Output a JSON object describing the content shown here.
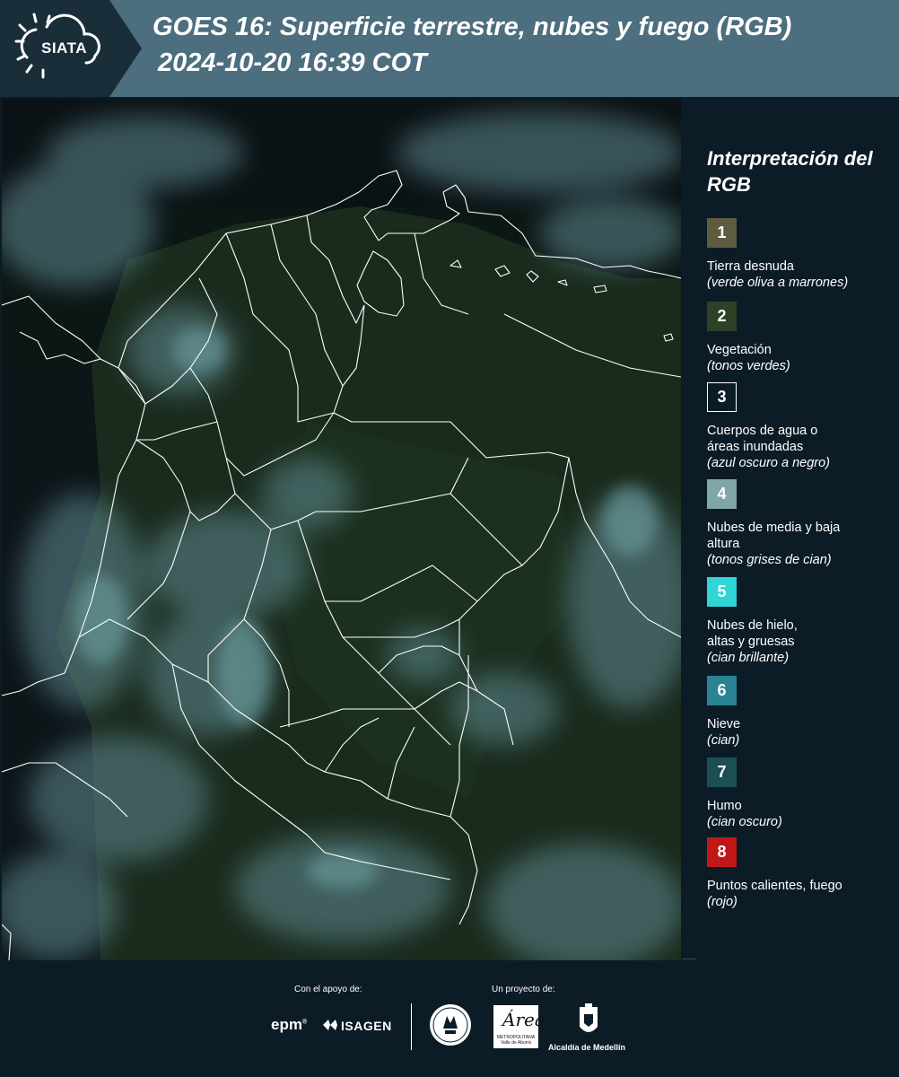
{
  "header": {
    "logo": "SIATA",
    "title_line1": "GOES 16: Superficie terrestre, nubes y fuego (RGB)",
    "title_line2": "2024-10-20 16:39 COT",
    "background": "#4c6e7e"
  },
  "map": {
    "icon": "satellite-map",
    "background": "#0b1312",
    "border_color": "#ffffff"
  },
  "legend": {
    "title": "Interpretación del RGB",
    "items": [
      {
        "number": "1",
        "color": "#5e5c3e",
        "label": "Tierra desnuda",
        "sub": "(verde oliva a marrones)"
      },
      {
        "number": "2",
        "color": "#2d4127",
        "label": "Vegetación",
        "sub": "(tonos verdes)"
      },
      {
        "number": "3",
        "color": "#0c1c26",
        "label": "Cuerpos de agua o áreas inundadas",
        "sub": "(azul oscuro a negro)"
      },
      {
        "number": "4",
        "color": "#7fa6a8",
        "label": "Nubes de media y baja altura",
        "sub": "(tonos grises de cian)"
      },
      {
        "number": "5",
        "color": "#2fd6d6",
        "label": "Nubes de hielo, altas y gruesas",
        "sub": "(cian brillante)"
      },
      {
        "number": "6",
        "color": "#2a8393",
        "label": "Nieve",
        "sub": "(cian)"
      },
      {
        "number": "7",
        "color": "#1b4f53",
        "label": "Humo",
        "sub": "(cian oscuro)"
      },
      {
        "number": "8",
        "color": "#c01818",
        "label": "Puntos calientes, fuego",
        "sub": "(rojo)"
      }
    ]
  },
  "footer": {
    "support_label": "Con el apoyo de:",
    "project_label": "Un proyecto de:",
    "epm": "epm",
    "epm_mark": "®",
    "isagen": "ISAGEN",
    "area_script": "Área",
    "area_small": "METROPOLITANA Valle de Aburrá",
    "alcaldia": "Alcaldía de Medellín"
  }
}
